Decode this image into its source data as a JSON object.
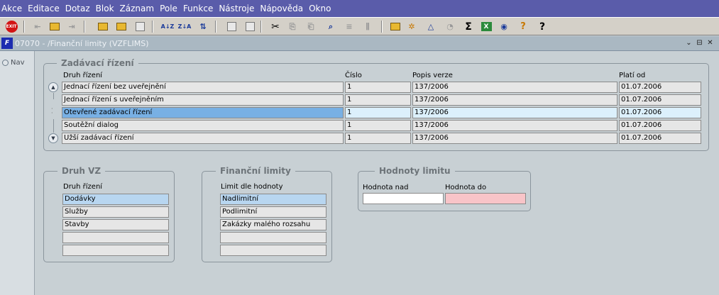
{
  "menu": [
    "Akce",
    "Editace",
    "Dotaz",
    "Blok",
    "Záznam",
    "Pole",
    "Funkce",
    "Nástroje",
    "Nápověda",
    "Okno"
  ],
  "toolbar": {
    "exit_label": "EXIT",
    "sort_az": "A↓Z",
    "sort_za": "Z↓A",
    "sigma": "Σ",
    "excel_label": "X",
    "help_label": "?",
    "help_pointer": "?"
  },
  "window": {
    "logo": "F",
    "title": "07070 - /Finanční limity (VZFLIMS)",
    "controls": [
      "⌄",
      "⊟",
      "✕"
    ]
  },
  "nav": {
    "label": "Nav"
  },
  "zadavaci": {
    "title": "Zadávací řízení",
    "columns": [
      "Druh řízení",
      "Číslo",
      "Popis verze",
      "Platí od"
    ],
    "rows": [
      [
        "Jednací řízení bez uveřejnění",
        "1",
        "137/2006",
        "01.07.2006"
      ],
      [
        "Jednací řízení s uveřejněním",
        "1",
        "137/2006",
        "01.07.2006"
      ],
      [
        "Otevřené zadávací řízení",
        "1",
        "137/2006",
        "01.07.2006"
      ],
      [
        "Soutěžní dialog",
        "1",
        "137/2006",
        "01.07.2006"
      ],
      [
        "Užší zadávací řízení",
        "1",
        "137/2006",
        "01.07.2006"
      ]
    ]
  },
  "druh_vz": {
    "title": "Druh VZ",
    "column": "Druh řízení",
    "items": [
      "Dodávky",
      "Služby",
      "Stavby",
      "",
      ""
    ]
  },
  "financni_limity": {
    "title": "Finanční limity",
    "column": "Limit dle hodnoty",
    "items": [
      "Nadlimitní",
      "Podlimitní",
      "Zakázky malého rozsahu",
      "",
      ""
    ]
  },
  "hodnoty_limitu": {
    "title": "Hodnoty limitu",
    "col_nad": "Hodnota nad",
    "col_do": "Hodnota do",
    "nad": "",
    "do": ""
  },
  "colors": {
    "menubar": "#5a5caa",
    "selected_row": "#78b0e4",
    "current_record": "#dcf0fc",
    "required_field": "#f8c4c8"
  }
}
